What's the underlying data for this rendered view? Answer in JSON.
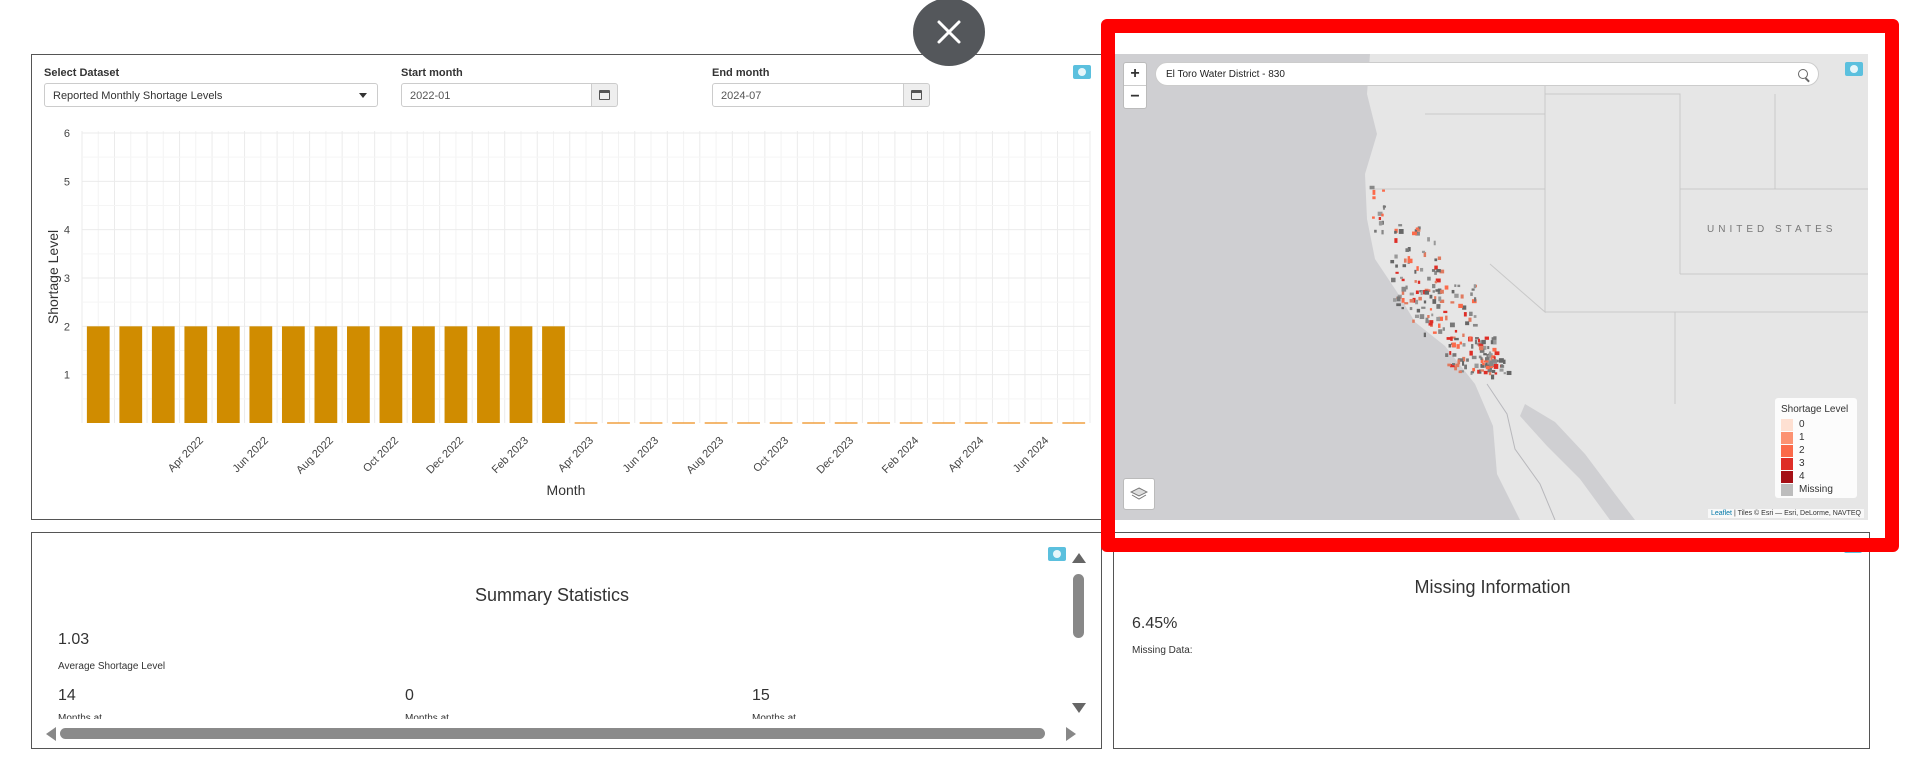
{
  "controls": {
    "dataset_label": "Select Dataset",
    "dataset_value": "Reported Monthly Shortage Levels",
    "start_label": "Start month",
    "start_value": "2022-01",
    "end_label": "End month",
    "end_value": "2024-07"
  },
  "chart_data": {
    "type": "bar",
    "ylabel": "Shortage Level",
    "xlabel": "Month",
    "ylim": [
      0,
      6
    ],
    "y_ticks": [
      1,
      2,
      3,
      4,
      5,
      6
    ],
    "grid": true,
    "bar_color": "#d08c00",
    "values": [
      2,
      2,
      2,
      2,
      2,
      2,
      2,
      2,
      2,
      2,
      2,
      2,
      2,
      2,
      2,
      0,
      0,
      0,
      0,
      0,
      0,
      0,
      0,
      0,
      0,
      0,
      0,
      0,
      0,
      0,
      0
    ],
    "x_tick_labels": [
      "Apr 2022",
      "Jun 2022",
      "Aug 2022",
      "Oct 2022",
      "Dec 2022",
      "Feb 2023",
      "Apr 2023",
      "Jun 2023",
      "Aug 2023",
      "Oct 2023",
      "Dec 2023",
      "Feb 2024",
      "Apr 2024",
      "Jun 2024"
    ]
  },
  "map": {
    "search_value": "El Toro Water District - 830",
    "country_label": "UNITED STATES",
    "zoom_in": "+",
    "zoom_out": "−",
    "legend_title": "Shortage Level",
    "legend_items": [
      {
        "label": "0",
        "color": "#fee0d2"
      },
      {
        "label": "1",
        "color": "#fc9272"
      },
      {
        "label": "2",
        "color": "#fb6a4a"
      },
      {
        "label": "3",
        "color": "#de2d26"
      },
      {
        "label": "4",
        "color": "#a50f15"
      },
      {
        "label": "Missing",
        "color": "#bdbdbd"
      }
    ],
    "attribution_link": "Leaflet",
    "attribution_text": " | Tiles © Esri — Esri, DeLorme, NAVTEQ"
  },
  "summary": {
    "title": "Summary Statistics",
    "avg_value": "1.03",
    "avg_label": "Average Shortage Level",
    "stat1_value": "14",
    "stat1_label": "Months at",
    "stat2_value": "0",
    "stat2_label": "Months at",
    "stat3_value": "15",
    "stat3_label": "Months at"
  },
  "missing": {
    "title": "Missing Information",
    "value": "6.45%",
    "label": "Missing Data:"
  },
  "colors": {
    "highlight": "#ff0000",
    "info": "#5bc0de",
    "accent_bar": "#d08c00"
  }
}
